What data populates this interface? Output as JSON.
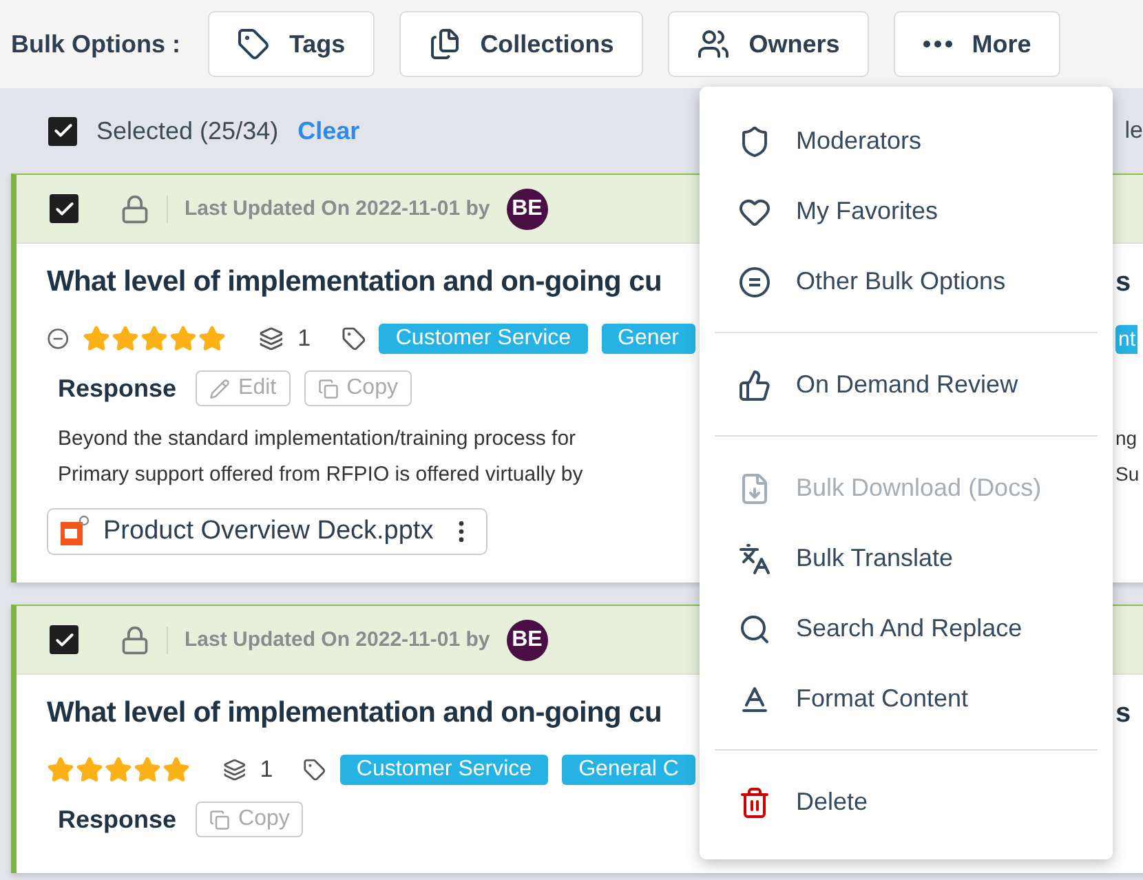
{
  "toolbar": {
    "label": "Bulk Options :",
    "buttons": [
      {
        "label": "Tags"
      },
      {
        "label": "Collections"
      },
      {
        "label": "Owners"
      },
      {
        "label": "More"
      }
    ]
  },
  "selection": {
    "checked": true,
    "label": "Selected (25/34)",
    "clear": "Clear",
    "fragment": "le"
  },
  "cards": [
    {
      "checked": true,
      "locked": true,
      "updated": "Last Updated On 2022-11-01 by",
      "avatar": "BE",
      "title": "What level of implementation and on-going cu",
      "title_fragment": "s",
      "minus": true,
      "stars": 5,
      "versions": "1",
      "tags": [
        {
          "label": "Customer Service"
        },
        {
          "label": "Gener"
        }
      ],
      "tag_fragment": "nt",
      "response_label": "Response",
      "actions": [
        {
          "kind": "edit",
          "label": "Edit"
        },
        {
          "kind": "copy",
          "label": "Copy"
        }
      ],
      "lines": [
        {
          "text": "Beyond the standard implementation/training process for",
          "fragment": "ng"
        },
        {
          "text": "Primary support offered from RFPIO is offered virtually by",
          "fragment": "Su"
        }
      ],
      "attachment": "Product Overview Deck.pptx"
    },
    {
      "checked": true,
      "locked": true,
      "updated": "Last Updated On 2022-11-01 by",
      "avatar": "BE",
      "title": "What level of implementation and on-going cu",
      "title_fragment": "s",
      "minus": false,
      "stars": 5,
      "versions": "1",
      "tags": [
        {
          "label": "Customer Service"
        },
        {
          "label": "General C"
        }
      ],
      "response_label": "Response",
      "actions": [
        {
          "kind": "copy",
          "label": "Copy"
        }
      ]
    }
  ],
  "menu": {
    "groups": [
      [
        {
          "label": "Moderators",
          "kind": "normal",
          "disabled": false
        },
        {
          "label": "My Favorites",
          "kind": "normal",
          "disabled": false
        },
        {
          "label": "Other Bulk Options",
          "kind": "normal",
          "disabled": false
        }
      ],
      [
        {
          "label": "On Demand Review",
          "kind": "normal",
          "disabled": false
        }
      ],
      [
        {
          "label": "Bulk Download (Docs)",
          "kind": "normal",
          "disabled": true
        },
        {
          "label": "Bulk Translate",
          "kind": "normal",
          "disabled": false
        },
        {
          "label": "Search And Replace",
          "kind": "normal",
          "disabled": false
        },
        {
          "label": "Format Content",
          "kind": "normal",
          "disabled": false
        }
      ],
      [
        {
          "label": "Delete",
          "kind": "danger",
          "disabled": false
        }
      ]
    ]
  }
}
